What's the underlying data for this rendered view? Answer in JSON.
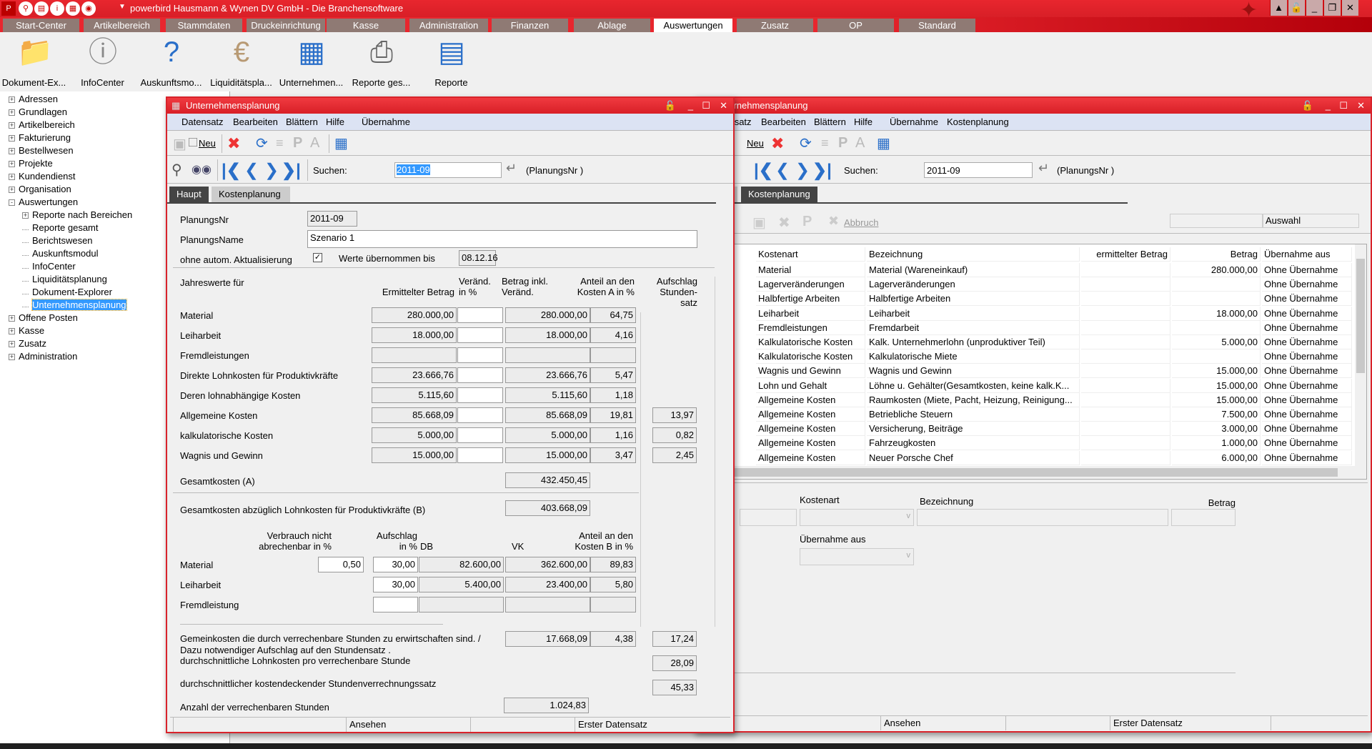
{
  "app": {
    "title": "powerbird  Hausmann & Wynen DV GmbH - Die Branchensoftware"
  },
  "main_tabs": [
    "Start-Center",
    "Artikelbereich",
    "Stammdaten",
    "Druckeinrichtung",
    "Kasse",
    "Administration",
    "Finanzen",
    "Ablage",
    "Auswertungen",
    "Zusatz",
    "OP",
    "Standard"
  ],
  "active_tab": "Auswertungen",
  "ribbon": [
    {
      "label": "Dokument-Ex...",
      "icon": "folder-search-icon"
    },
    {
      "label": "InfoCenter",
      "icon": "info-icon"
    },
    {
      "label": "Auskunftsmo...",
      "icon": "document-question-icon"
    },
    {
      "label": "Liquiditätspla...",
      "icon": "money-bag-icon"
    },
    {
      "label": "Unternehmen...",
      "icon": "calendar-chart-icon"
    },
    {
      "label": "Reporte ges...",
      "icon": "printer-icon"
    },
    {
      "label": "Reporte",
      "icon": "report-chart-icon"
    }
  ],
  "tree": [
    {
      "label": "Adressen",
      "level": 0,
      "exp": "+"
    },
    {
      "label": "Grundlagen",
      "level": 0,
      "exp": "+"
    },
    {
      "label": "Artikelbereich",
      "level": 0,
      "exp": "+"
    },
    {
      "label": "Fakturierung",
      "level": 0,
      "exp": "+"
    },
    {
      "label": "Bestellwesen",
      "level": 0,
      "exp": "+"
    },
    {
      "label": "Projekte",
      "level": 0,
      "exp": "+"
    },
    {
      "label": "Kundendienst",
      "level": 0,
      "exp": "+"
    },
    {
      "label": "Organisation",
      "level": 0,
      "exp": "+"
    },
    {
      "label": "Auswertungen",
      "level": 0,
      "exp": "-"
    },
    {
      "label": "Reporte nach Bereichen",
      "level": 1,
      "exp": "+"
    },
    {
      "label": "Reporte gesamt",
      "level": 1
    },
    {
      "label": "Berichtswesen",
      "level": 1
    },
    {
      "label": "Auskunftsmodul",
      "level": 1
    },
    {
      "label": "InfoCenter",
      "level": 1
    },
    {
      "label": "Liquiditätsplanung",
      "level": 1
    },
    {
      "label": "Dokument-Explorer",
      "level": 1
    },
    {
      "label": "Unternehmensplanung",
      "level": 1,
      "selected": true
    },
    {
      "label": "Offene Posten",
      "level": 0,
      "exp": "+"
    },
    {
      "label": "Kasse",
      "level": 0,
      "exp": "+"
    },
    {
      "label": "Zusatz",
      "level": 0,
      "exp": "+"
    },
    {
      "label": "Administration",
      "level": 0,
      "exp": "+"
    }
  ],
  "dialog": {
    "title": "Unternehmensplanung",
    "menu": [
      "Datensatz",
      "Bearbeiten",
      "Blättern",
      "Hilfe",
      "Übernahme"
    ],
    "menu_right": [
      "Datensatz",
      "Bearbeiten",
      "Blättern",
      "Hilfe",
      "Übernahme",
      "Kostenplanung"
    ],
    "new_label": "Neu",
    "search_label": "Suchen:",
    "search_value": "2011-09",
    "search_field": "(PlanungsNr )",
    "tabs": [
      "Haupt",
      "Kostenplanung"
    ],
    "planungsnr_label": "PlanungsNr",
    "planungsnr": "2011-09",
    "planungsname_label": "PlanungsName",
    "planungsname": "Szenario 1",
    "ohne_label": "ohne autom. Aktualisierung",
    "ohne_checked": true,
    "werte_label": "Werte übernommen bis",
    "werte_date": "08.12.16",
    "head": {
      "jahres": "Jahreswerte für",
      "ermittelt": "Ermittelter Betrag",
      "veraend": "Veränd.\nin %",
      "betrag": "Betrag inkl.\nVeränd.",
      "anteil": "Anteil an den\nKosten A in %",
      "aufschlag": "Aufschlag\nStunden-\nsatz"
    },
    "rows": [
      {
        "label": "Material",
        "ermittelt": "280.000,00",
        "veraend": "",
        "betrag": "280.000,00",
        "anteil": "64,75",
        "aufschlag": null
      },
      {
        "label": "Leiharbeit",
        "ermittelt": "18.000,00",
        "veraend": "",
        "betrag": "18.000,00",
        "anteil": "4,16",
        "aufschlag": null
      },
      {
        "label": "Fremdleistungen",
        "ermittelt": "",
        "veraend": "",
        "betrag": "",
        "anteil": "",
        "aufschlag": null
      },
      {
        "label": "Direkte Lohnkosten für Produktivkräfte",
        "ermittelt": "23.666,76",
        "veraend": "",
        "betrag": "23.666,76",
        "anteil": "5,47",
        "aufschlag": null
      },
      {
        "label": "Deren lohnabhängige Kosten",
        "ermittelt": "5.115,60",
        "veraend": "",
        "betrag": "5.115,60",
        "anteil": "1,18",
        "aufschlag": null
      },
      {
        "label": "Allgemeine Kosten",
        "ermittelt": "85.668,09",
        "veraend": "",
        "betrag": "85.668,09",
        "anteil": "19,81",
        "aufschlag": "13,97"
      },
      {
        "label": "kalkulatorische Kosten",
        "ermittelt": "5.000,00",
        "veraend": "",
        "betrag": "5.000,00",
        "anteil": "1,16",
        "aufschlag": "0,82"
      },
      {
        "label": "Wagnis und Gewinn",
        "ermittelt": "15.000,00",
        "veraend": "",
        "betrag": "15.000,00",
        "anteil": "3,47",
        "aufschlag": "2,45"
      }
    ],
    "gesamt_a_label": "Gesamtkosten (A)",
    "gesamt_a": "432.450,45",
    "gesamt_b_label": "Gesamtkosten abzüglich Lohnkosten für Produktivkräfte (B)",
    "gesamt_b": "403.668,09",
    "head2": {
      "verbrauch": "Verbrauch nicht\nabrechenbar in %",
      "aufschlag": "Aufschlag\nin %",
      "db": "DB",
      "vk": "VK",
      "anteil": "Anteil an den\nKosten B in %"
    },
    "rows2": [
      {
        "label": "Material",
        "verbrauch": "0,50",
        "aufschlag": "30,00",
        "db": "82.600,00",
        "vk": "362.600,00",
        "anteil": "89,83"
      },
      {
        "label": "Leiharbeit",
        "verbrauch": null,
        "aufschlag": "30,00",
        "db": "5.400,00",
        "vk": "23.400,00",
        "anteil": "5,80"
      },
      {
        "label": "Fremdleistung",
        "verbrauch": null,
        "aufschlag": "",
        "db": "",
        "vk": "",
        "anteil": ""
      }
    ],
    "gemein_label": "Gemeinkosten die durch verrechenbare Stunden zu erwirtschaften sind. /\nDazu notwendiger Aufschlag auf den Stundensatz .",
    "gemein_betrag": "17.668,09",
    "gemein_anteil": "4,38",
    "gemein_aufschlag": "17,24",
    "lohn_label": "durchschnittliche Lohnkosten pro verrechenbare Stunde",
    "lohn": "28,09",
    "satz_label": "durchschnittlicher kostendeckender Stundenverrechnungssatz",
    "satz": "45,33",
    "stunden_label": "Anzahl der verrechenbaren Stunden",
    "stunden": "1.024,83",
    "status": [
      "",
      "Ansehen",
      "",
      "Erster Datensatz"
    ]
  },
  "right": {
    "title": "Unternehmensplanung",
    "abbruch": "Abbruch",
    "auswahl": "Auswahl",
    "columns": [
      "Kostenart",
      "Bezeichnung",
      "ermittelter Betrag",
      "Betrag",
      "Übernahme aus"
    ],
    "rows": [
      [
        "Material",
        "Material (Wareneinkauf)",
        "",
        "280.000,00",
        "Ohne Übernahme"
      ],
      [
        "Lagerveränderungen",
        "Lagerveränderungen",
        "",
        "",
        "Ohne Übernahme"
      ],
      [
        "Halbfertige Arbeiten",
        "Halbfertige Arbeiten",
        "",
        "",
        "Ohne Übernahme"
      ],
      [
        "Leiharbeit",
        "Leiharbeit",
        "",
        "18.000,00",
        "Ohne Übernahme"
      ],
      [
        "Fremdleistungen",
        "Fremdarbeit",
        "",
        "",
        "Ohne Übernahme"
      ],
      [
        "Kalkulatorische Kosten",
        "Kalk. Unternehmerlohn (unproduktiver Teil)",
        "",
        "5.000,00",
        "Ohne Übernahme"
      ],
      [
        "Kalkulatorische Kosten",
        "Kalkulatorische Miete",
        "",
        "",
        "Ohne Übernahme"
      ],
      [
        "Wagnis und Gewinn",
        "Wagnis und Gewinn",
        "",
        "15.000,00",
        "Ohne Übernahme"
      ],
      [
        "Lohn und Gehalt",
        "Löhne u. Gehälter(Gesamtkosten, keine kalk.K...",
        "",
        "15.000,00",
        "Ohne Übernahme"
      ],
      [
        "Allgemeine Kosten",
        "Raumkosten (Miete, Pacht, Heizung, Reinigung...",
        "",
        "15.000,00",
        "Ohne Übernahme"
      ],
      [
        "Allgemeine Kosten",
        "Betriebliche Steuern",
        "",
        "7.500,00",
        "Ohne Übernahme"
      ],
      [
        "Allgemeine Kosten",
        "Versicherung, Beiträge",
        "",
        "3.000,00",
        "Ohne Übernahme"
      ],
      [
        "Allgemeine Kosten",
        "Fahrzeugkosten",
        "",
        "1.000,00",
        "Ohne Übernahme"
      ],
      [
        "Allgemeine Kosten",
        "Neuer Porsche Chef",
        "",
        "6.000,00",
        "Ohne Übernahme"
      ]
    ],
    "edit": {
      "kostenart": "Kostenart",
      "bezeichnung": "Bezeichnung",
      "betrag": "Betrag",
      "uebernahme": "Übernahme aus"
    },
    "status": [
      "Ansehen",
      "Erster Datensatz"
    ]
  },
  "colors": {
    "brand_red": "#e8262e",
    "tab_gray": "#8f7a74",
    "menu_blue": "#dce3f3",
    "selection": "#3399ff"
  }
}
